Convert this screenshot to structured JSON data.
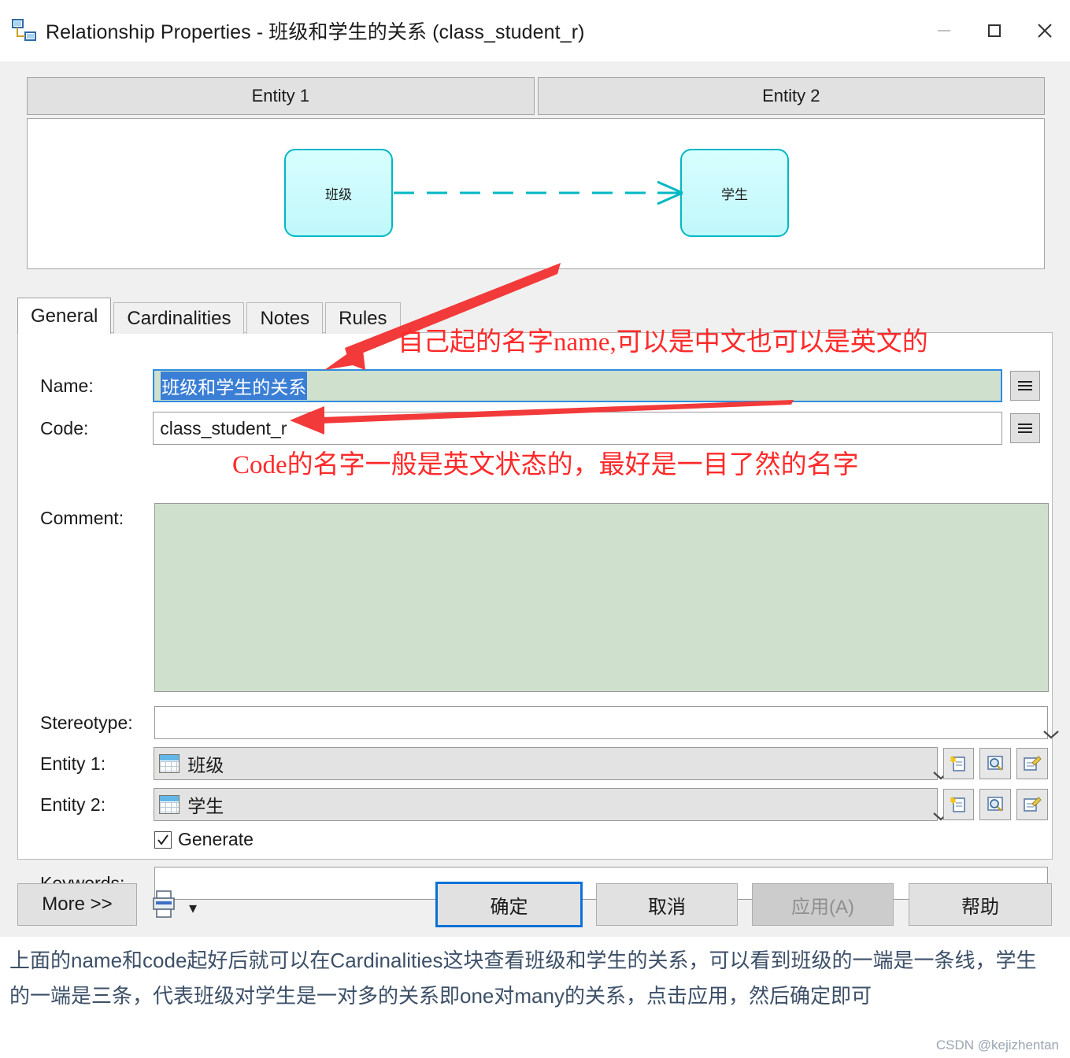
{
  "window": {
    "title": "Relationship Properties - 班级和学生的关系 (class_student_r)",
    "icon": "relationship-icon",
    "minimize": "–",
    "maximize": "❐",
    "close": "✕"
  },
  "entity_headers": [
    {
      "label": "Entity 1"
    },
    {
      "label": "Entity 2"
    }
  ],
  "preview": {
    "entity1": "班级",
    "entity2": "学生",
    "relation_style": "dashed-line-crowsfoot",
    "line_color": "#00b8c4",
    "box_fill": "#ccf8fb"
  },
  "tabs": [
    {
      "label": "General",
      "active": true
    },
    {
      "label": "Cardinalities",
      "active": false
    },
    {
      "label": "Notes",
      "active": false
    },
    {
      "label": "Rules",
      "active": false
    }
  ],
  "form": {
    "name": {
      "label": "Name:",
      "value": "班级和学生的关系",
      "selected": true,
      "equals_button": "="
    },
    "code": {
      "label": "Code:",
      "value": "class_student_r",
      "equals_button": "="
    },
    "comment": {
      "label": "Comment:",
      "value": ""
    },
    "stereotype": {
      "label": "Stereotype:",
      "value": "",
      "caret": "chevron-down-icon"
    },
    "entity1": {
      "label": "Entity 1:",
      "value": "班级",
      "icon": "table-icon",
      "caret": "chevron-down-icon",
      "buttons": [
        "create-icon",
        "find-icon",
        "properties-icon"
      ]
    },
    "entity2": {
      "label": "Entity 2:",
      "value": "学生",
      "icon": "table-icon",
      "caret": "chevron-down-icon",
      "buttons": [
        "create-icon",
        "find-icon",
        "properties-icon"
      ]
    },
    "generate": {
      "label": "Generate",
      "checked": true,
      "check_glyph": "✓"
    },
    "keywords": {
      "label": "Keywords:",
      "value": ""
    }
  },
  "footer": {
    "more": "More >>",
    "print_icon": "printer-icon",
    "print_caret": "▾",
    "ok": "确定",
    "cancel": "取消",
    "apply": "应用(A)",
    "help": "帮助"
  },
  "annotations": [
    {
      "id": "annot-name",
      "text": "自己起的名字name,可以是中文也可以是英文的",
      "color": "#ff2a2a"
    },
    {
      "id": "annot-code",
      "text": "Code的名字一般是英文状态的，最好是一目了然的名字",
      "color": "#ff2a2a"
    }
  ],
  "caption": {
    "text": "上面的name和code起好后就可以在Cardinalities这块查看班级和学生的关系，可以看到班级的一端是一条线，学生的一端是三条，代表班级对学生是一对多的关系即one对many的关系，点击应用，然后确定即可",
    "watermark": "CSDN @kejizhentan"
  }
}
